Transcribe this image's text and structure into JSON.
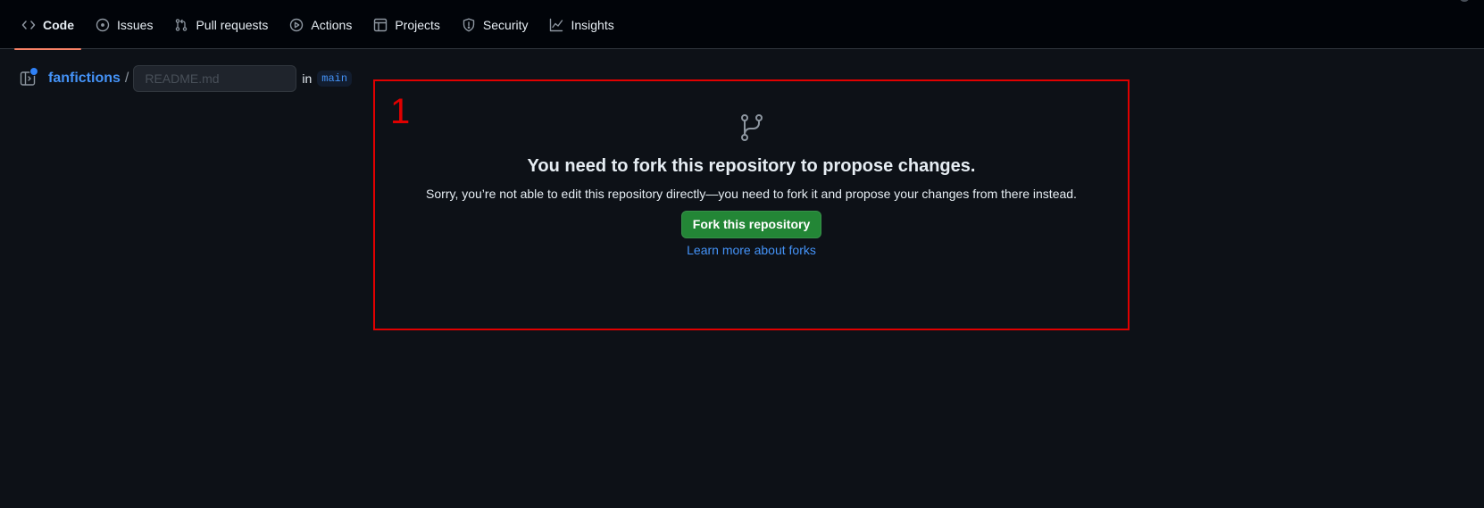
{
  "colors": {
    "background": "#0d1117",
    "nav_background": "#010409",
    "accent_underline": "#f78166",
    "link": "#4493f8",
    "primary_button": "#238636",
    "annotation": "#e00000"
  },
  "nav": {
    "tabs": [
      {
        "label": "Code",
        "icon": "code-icon",
        "selected": true
      },
      {
        "label": "Issues",
        "icon": "issue-opened-icon",
        "selected": false
      },
      {
        "label": "Pull requests",
        "icon": "git-pull-request-icon",
        "selected": false
      },
      {
        "label": "Actions",
        "icon": "play-icon",
        "selected": false
      },
      {
        "label": "Projects",
        "icon": "table-icon",
        "selected": false
      },
      {
        "label": "Security",
        "icon": "shield-icon",
        "selected": false
      },
      {
        "label": "Insights",
        "icon": "graph-icon",
        "selected": false
      }
    ]
  },
  "breadcrumb": {
    "repo": "fanfictions",
    "separator": "/",
    "filename_placeholder": "README.md",
    "filename_value": "",
    "in_label": "in",
    "branch": "main"
  },
  "annotation": {
    "number": "1"
  },
  "blankslate": {
    "icon": "git-branch-icon",
    "title": "You need to fork this repository to propose changes.",
    "description": "Sorry, you’re not able to edit this repository directly—you need to fork it and propose your changes from there instead.",
    "fork_button": "Fork this repository",
    "learn_link": "Learn more about forks"
  }
}
